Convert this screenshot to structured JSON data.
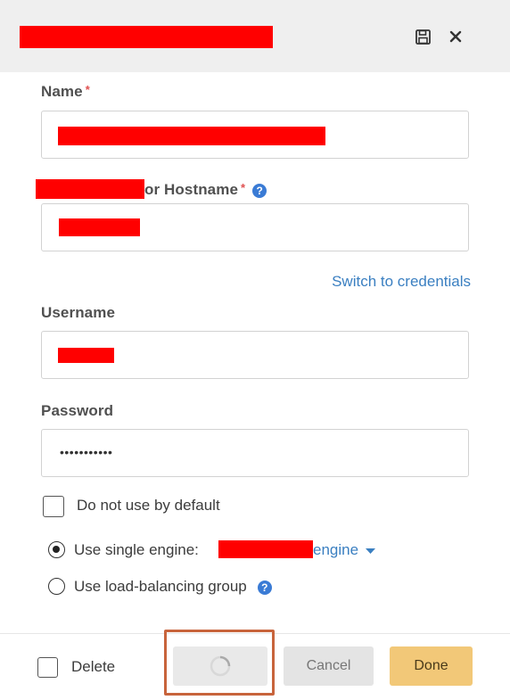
{
  "header": {
    "save_icon": "save-icon",
    "close_icon": "close-icon"
  },
  "form": {
    "name_label": "Name",
    "host_label": "or Hostname",
    "required_mark": "*",
    "help_glyph": "?",
    "switch_link": "Switch to credentials",
    "username_label": "Username",
    "password_label": "Password",
    "password_value": "•••••••••••",
    "no_default_label": "Do not use by default",
    "single_engine_label": "Use single engine:",
    "engine_suffix": "engine",
    "lb_group_label": "Use load-balancing group"
  },
  "footer": {
    "delete_label": "Delete",
    "cancel_label": "Cancel",
    "done_label": "Done"
  },
  "colors": {
    "accent_link": "#3a7fc1",
    "done_button": "#f2c878",
    "highlight_box": "#c8643c"
  }
}
